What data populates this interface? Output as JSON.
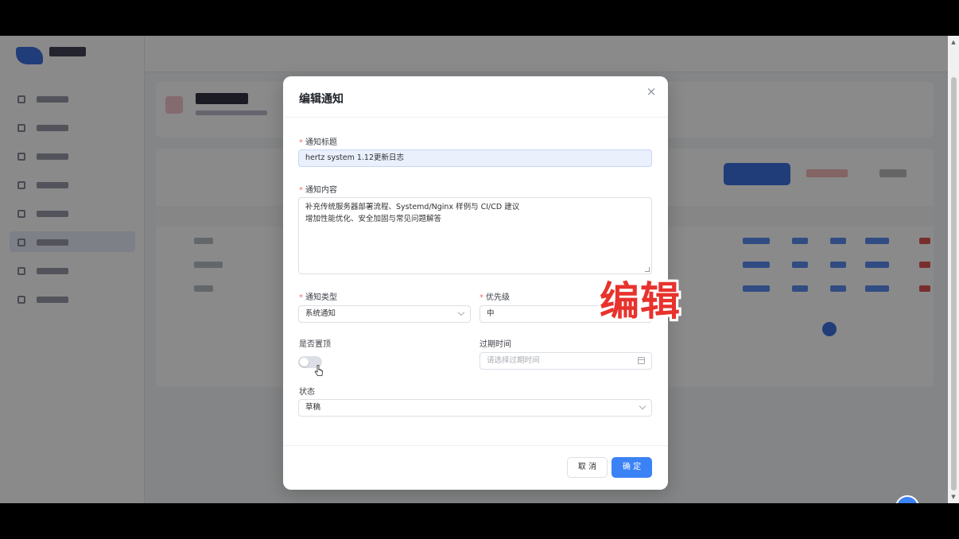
{
  "modal": {
    "title": "编辑通知",
    "fields": {
      "title_label": "通知标题",
      "title_value": "hertz system 1.12更新日志",
      "content_label": "通知内容",
      "content_line1": "补充传统服务器部署流程、Systemd/Nginx 样例与 CI/CD 建议",
      "content_line2": "增加性能优化、安全加固与常见问题解答",
      "type_label": "通知类型",
      "type_value": "系统通知",
      "priority_label": "优先级",
      "priority_value": "中",
      "pinned_label": "是否置顶",
      "pinned": false,
      "expire_label": "过期时间",
      "expire_placeholder": "请选择过期时间",
      "status_label": "状态",
      "status_value": "草稿"
    },
    "buttons": {
      "cancel": "取 消",
      "confirm": "确 定"
    }
  },
  "overlay_caption": "编辑",
  "colors": {
    "primary": "#3b82f6",
    "required": "#f56c6c",
    "caption": "#e8322d"
  }
}
